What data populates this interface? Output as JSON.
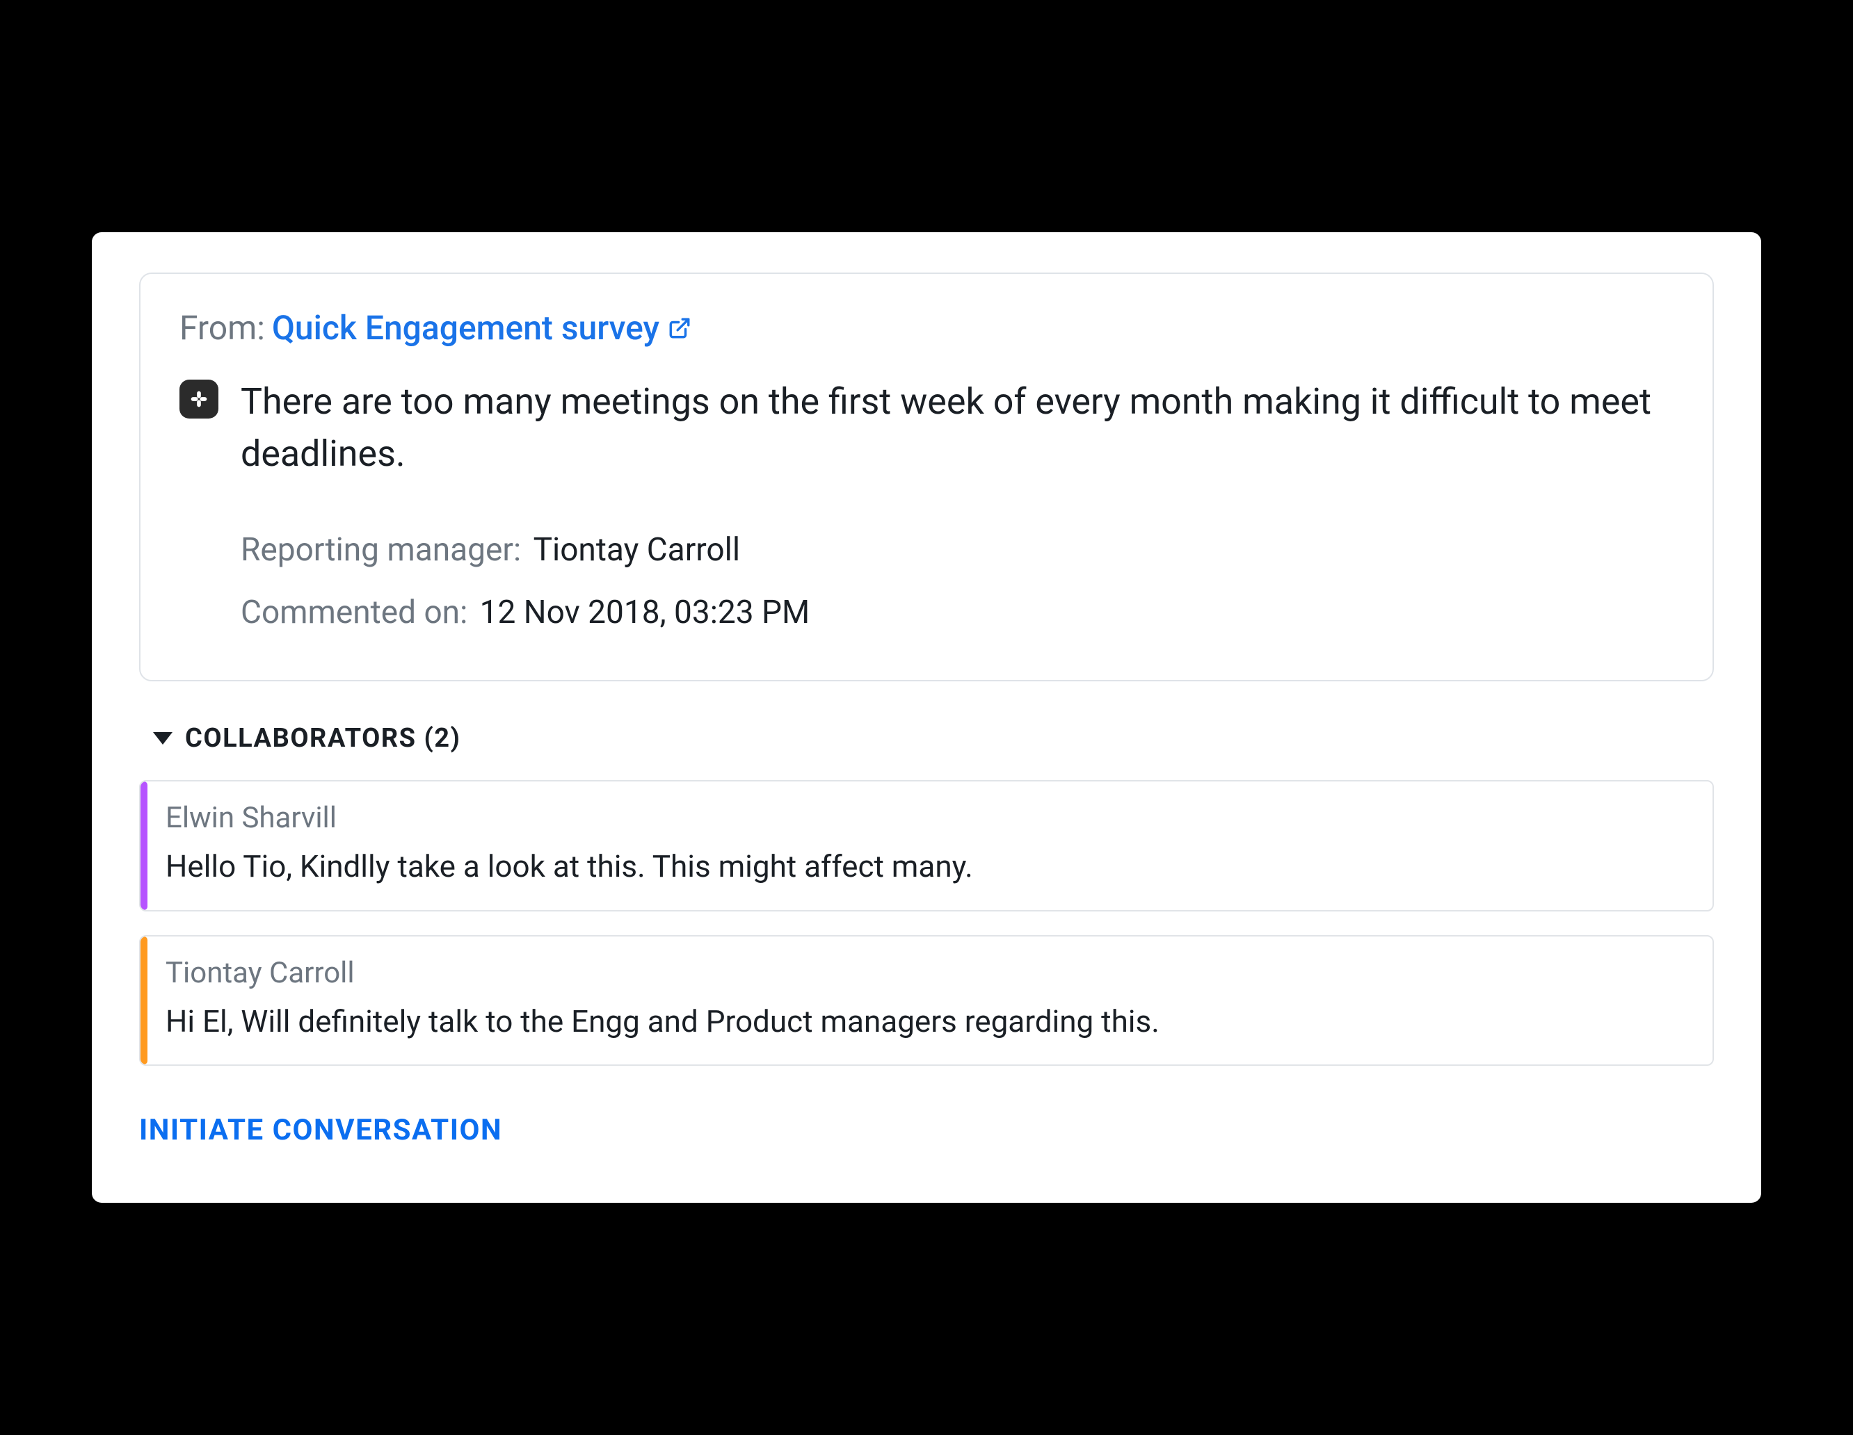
{
  "source": {
    "from_label": "From:",
    "link_text": "Quick Engagement survey",
    "body": "There are too many meetings on the first week of every month making it difficult to meet deadlines.",
    "meta": {
      "reporting_manager_label": "Reporting manager:",
      "reporting_manager_value": "Tiontay Carroll",
      "commented_on_label": "Commented on:",
      "commented_on_value": "12 Nov 2018, 03:23 PM"
    }
  },
  "collaborators": {
    "header": "COLLABORATORS (2)",
    "items": [
      {
        "author": "Elwin Sharvill",
        "text": "Hello Tio, Kindlly take a look at this. This might affect many.",
        "stripe": "#b653ff"
      },
      {
        "author": "Tiontay Carroll",
        "text": "Hi El, Will definitely talk to the Engg and Product managers regarding this.",
        "stripe": "#ff9a1f"
      }
    ]
  },
  "actions": {
    "initiate": "INITIATE CONVERSATION"
  }
}
